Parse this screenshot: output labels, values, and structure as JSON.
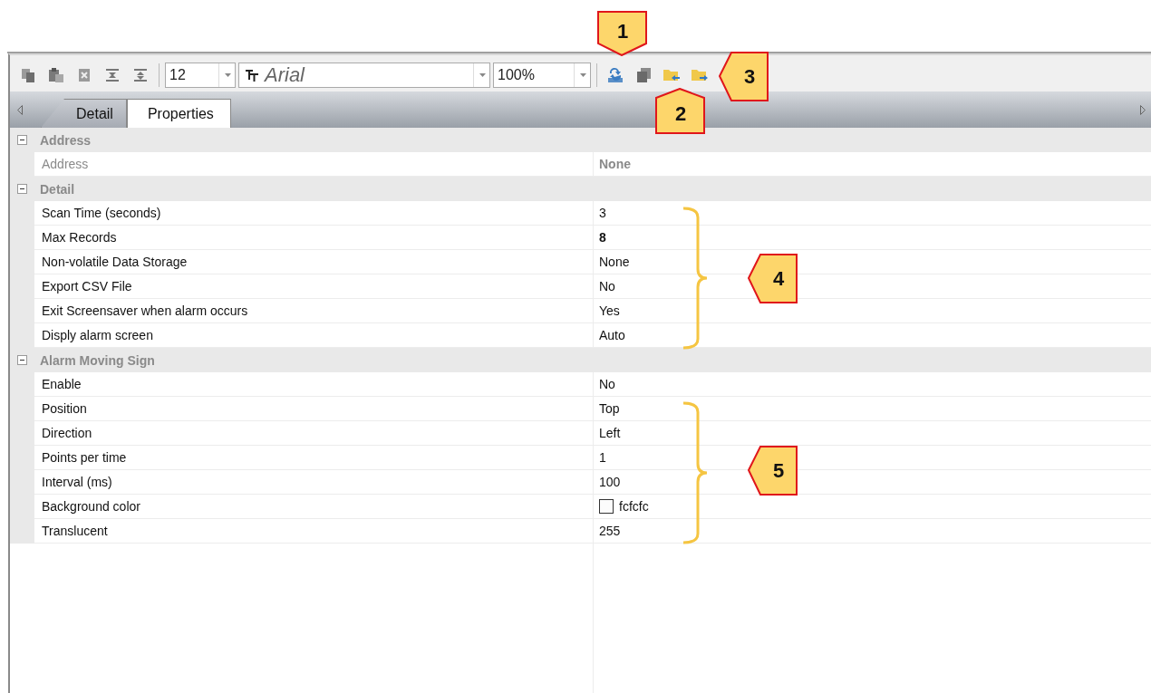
{
  "toolbar": {
    "font_size": "12",
    "font": "Arial",
    "zoom": "100%"
  },
  "tabs": [
    {
      "label": "Detail",
      "selected": false
    },
    {
      "label": "Properties",
      "selected": true
    }
  ],
  "sections": [
    {
      "title": "Address",
      "expanded": true,
      "rows": [
        {
          "name": "Address",
          "value": "None",
          "disabled": true,
          "bold": true
        }
      ]
    },
    {
      "title": "Detail",
      "expanded": true,
      "rows": [
        {
          "name": "Scan Time (seconds)",
          "value": "3",
          "disabled": false,
          "bold": false
        },
        {
          "name": "Max Records",
          "value": "8",
          "disabled": false,
          "bold": true
        },
        {
          "name": "Non-volatile Data Storage",
          "value": "None",
          "disabled": false,
          "bold": false
        },
        {
          "name": "Export CSV File",
          "value": "No",
          "disabled": false,
          "bold": false
        },
        {
          "name": "Exit Screensaver when alarm occurs",
          "value": "Yes",
          "disabled": false,
          "bold": false
        },
        {
          "name": "Disply alarm screen",
          "value": "Auto",
          "disabled": false,
          "bold": false
        }
      ]
    },
    {
      "title": "Alarm Moving Sign",
      "expanded": true,
      "rows": [
        {
          "name": "Enable",
          "value": "No",
          "disabled": false,
          "bold": false
        },
        {
          "name": "Position",
          "value": "Top",
          "disabled": false,
          "bold": false
        },
        {
          "name": "Direction",
          "value": "Left",
          "disabled": false,
          "bold": false
        },
        {
          "name": "Points per time",
          "value": "1",
          "disabled": false,
          "bold": false
        },
        {
          "name": "Interval (ms)",
          "value": "100",
          "disabled": false,
          "bold": false
        },
        {
          "name": "Background color",
          "value": "fcfcfc",
          "disabled": false,
          "bold": false,
          "color": "#fcfcfc"
        },
        {
          "name": "Translucent",
          "value": "255",
          "disabled": false,
          "bold": false
        }
      ]
    }
  ],
  "callouts": [
    {
      "label": "1",
      "kind": "down"
    },
    {
      "label": "2",
      "kind": "up"
    },
    {
      "label": "3",
      "kind": "left"
    },
    {
      "label": "4",
      "kind": "left"
    },
    {
      "label": "5",
      "kind": "left"
    }
  ]
}
